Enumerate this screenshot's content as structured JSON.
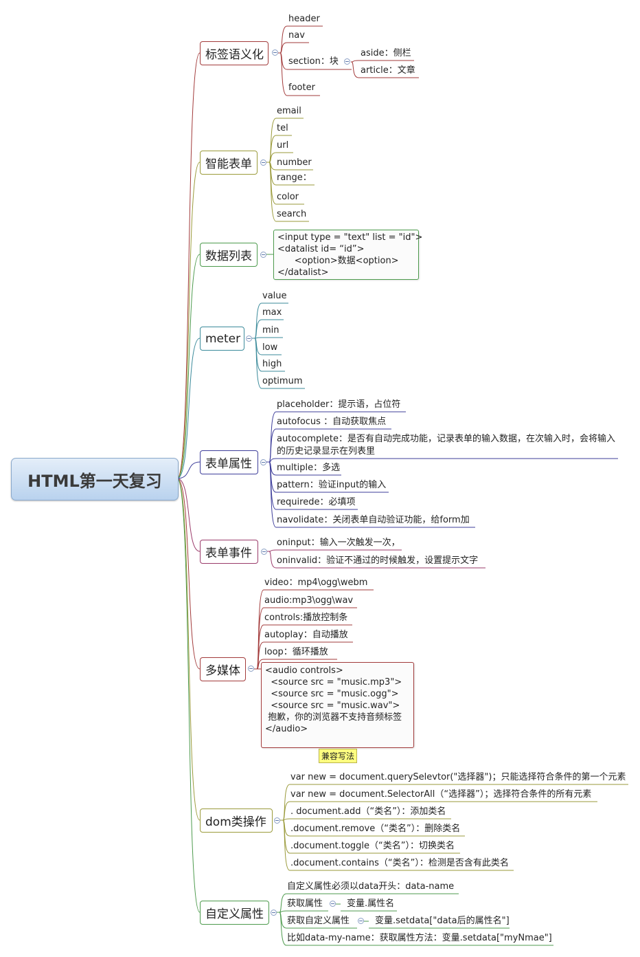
{
  "root": "HTML第一天复习",
  "topics": {
    "semantic": {
      "label": "标签语义化",
      "items": [
        "header",
        "nav",
        "section：块",
        "footer"
      ],
      "section_children": [
        "aside：侧栏",
        "article：文章"
      ]
    },
    "smart_form": {
      "label": "智能表单",
      "items": [
        "email",
        "tel",
        "url",
        "number",
        "range：",
        "color",
        "search"
      ]
    },
    "datalist": {
      "label": "数据列表",
      "code": [
        "<input type = \"text\" list = \"id\">",
        "<datalist id= “id”>",
        "      <option>数据<option>",
        "</datalist>"
      ]
    },
    "meter": {
      "label": "meter",
      "items": [
        "value",
        "max",
        "min",
        "low",
        "high",
        "optimum"
      ]
    },
    "form_attrs": {
      "label": "表单属性",
      "items": [
        "placeholder：提示语，占位符",
        "autofocus ：自动获取焦点",
        "autocomplete：是否有自动完成功能，记录表单的输入数据，在次输入时，会将输入的历史记录显示在列表里",
        "multiple：多选",
        "pattern：验证input的输入",
        "requirede：必填项",
        "navolidate：关闭表单自动验证功能，给form加"
      ]
    },
    "form_events": {
      "label": "表单事件",
      "items": [
        "oninput：输入一次触发一次，",
        "oninvalid：验证不通过的时候触发，设置提示文字"
      ]
    },
    "media": {
      "label": "多媒体",
      "items": [
        "video：mp4\\ogg\\webm",
        "audio:mp3\\ogg\\wav",
        "controls:播放控制条",
        "autoplay：自动播放",
        "loop：循环播放"
      ],
      "code": [
        "<audio controls>",
        "  <source src = \"music.mp3\">",
        "  <source src = \"music.ogg\">",
        "  <source src = \"music.wav\">",
        " 抱歉，你的浏览器不支持音频标签",
        "</audio>"
      ],
      "callout": "兼容写法"
    },
    "dom": {
      "label": "dom类操作",
      "items": [
        "var new = document.querySelevtor(\"选择器\")；只能选择符合条件的第一个元素",
        "var new = document.SelectorAll（“选择器”）；选择符合条件的所有元素",
        ". document.add（“类名”）：添加类名",
        ".document.remove（“类名”）：删除类名",
        ".document.toggle（“类名”）：切换类名",
        ".document.contains（“类名”）：检测是否含有此类名"
      ]
    },
    "custom_attrs": {
      "label": "自定义属性",
      "items": [
        "自定义属性必须以data开头：data-name",
        "获取属性",
        "获取自定义属性",
        "比如data-my-name：获取属性方法：变量.setdata[\"myNmae\"]"
      ],
      "item1_child": "变量.属性名",
      "item2_child": "变量.setdata[\"data后的属性名\"]"
    }
  },
  "colors": {
    "semantic": "#a23a3a",
    "smart_form": "#9a9a3a",
    "datalist": "#4c9a4c",
    "meter": "#3a8a9a",
    "form_attrs": "#3d3d9a",
    "form_events": "#9a3a6a",
    "media": "#a23a3a",
    "dom": "#9a9a3a",
    "custom_attrs": "#4c9a4c"
  }
}
